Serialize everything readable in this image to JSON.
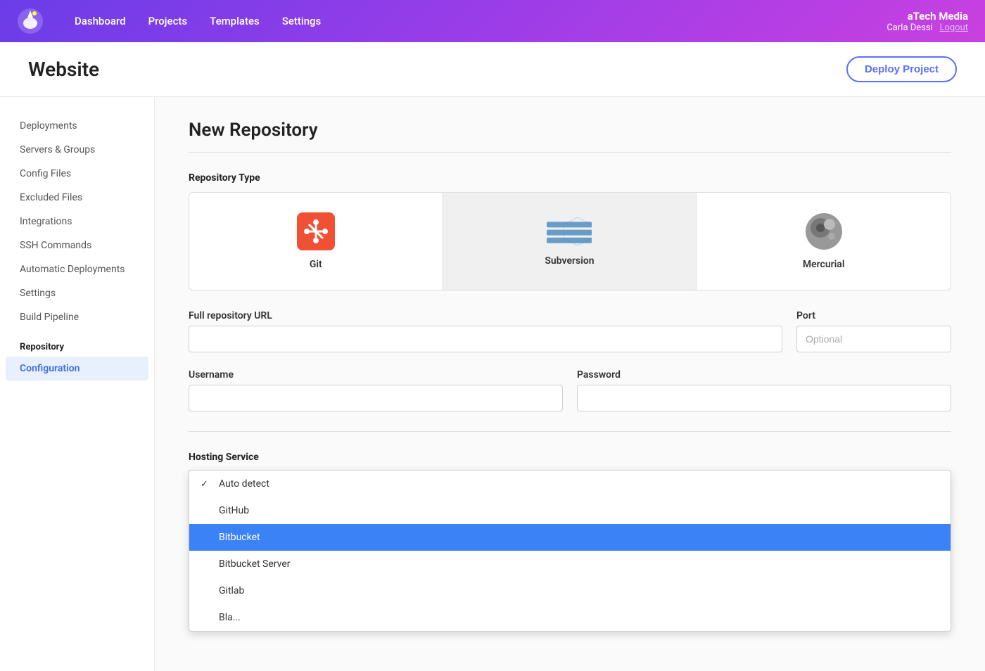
{
  "brand": {
    "company": "aTech Media",
    "user": "Carla Dessi",
    "logout_label": "Logout"
  },
  "nav": {
    "links": [
      "Dashboard",
      "Projects",
      "Templates",
      "Settings"
    ]
  },
  "page": {
    "title": "Website",
    "deploy_button": "Deploy Project"
  },
  "sidebar": {
    "items": [
      {
        "id": "deployments",
        "label": "Deployments",
        "active": false
      },
      {
        "id": "servers-groups",
        "label": "Servers & Groups",
        "active": false
      },
      {
        "id": "config-files",
        "label": "Config Files",
        "active": false
      },
      {
        "id": "excluded-files",
        "label": "Excluded Files",
        "active": false
      },
      {
        "id": "integrations",
        "label": "Integrations",
        "active": false
      },
      {
        "id": "ssh-commands",
        "label": "SSH Commands",
        "active": false
      },
      {
        "id": "automatic-deployments",
        "label": "Automatic Deployments",
        "active": false
      },
      {
        "id": "settings",
        "label": "Settings",
        "active": false
      },
      {
        "id": "build-pipeline",
        "label": "Build Pipeline",
        "active": false
      }
    ],
    "repository_section": "Repository",
    "repository_items": [
      {
        "id": "configuration",
        "label": "Configuration",
        "active": true
      }
    ]
  },
  "form": {
    "section_title": "New Repository",
    "repo_type_label": "Repository Type",
    "repo_types": [
      {
        "id": "git",
        "label": "Git",
        "selected": false
      },
      {
        "id": "subversion",
        "label": "Subversion",
        "selected": true
      },
      {
        "id": "mercurial",
        "label": "Mercurial",
        "selected": false
      }
    ],
    "url_label": "Full repository URL",
    "url_placeholder": "",
    "port_label": "Port",
    "port_placeholder": "Optional",
    "username_label": "Username",
    "username_placeholder": "",
    "password_label": "Password",
    "password_placeholder": "",
    "hosting_label": "Hosting Service",
    "hosting_options": [
      {
        "id": "auto-detect",
        "label": "Auto detect",
        "checked": true,
        "highlighted": false
      },
      {
        "id": "github",
        "label": "GitHub",
        "checked": false,
        "highlighted": false
      },
      {
        "id": "bitbucket",
        "label": "Bitbucket",
        "checked": false,
        "highlighted": true
      },
      {
        "id": "bitbucket-server",
        "label": "Bitbucket Server",
        "checked": false,
        "highlighted": false
      },
      {
        "id": "gitlab",
        "label": "Gitlab",
        "checked": false,
        "highlighted": false
      },
      {
        "id": "bla",
        "label": "Bla...",
        "checked": false,
        "highlighted": false
      }
    ]
  }
}
